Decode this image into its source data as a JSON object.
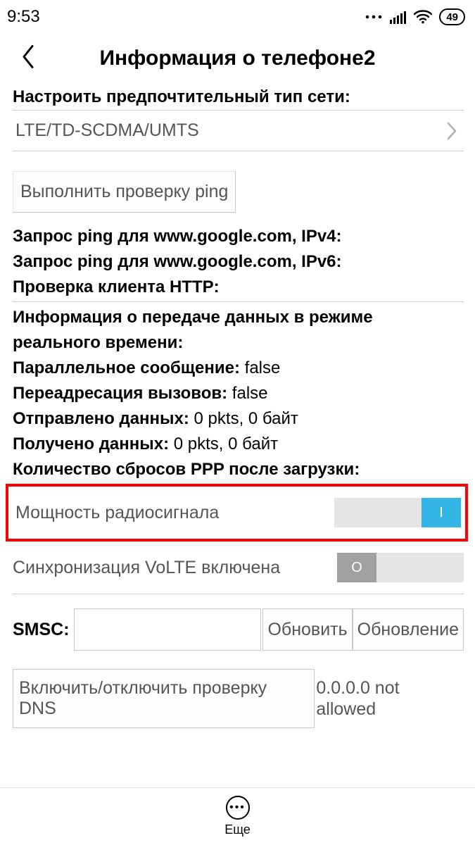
{
  "statusbar": {
    "time": "9:53",
    "battery": "49"
  },
  "title": "Информация о телефоне2",
  "network": {
    "label": "Настроить предпочтительный тип сети:",
    "value": "LTE/TD-SCDMA/UMTS"
  },
  "ping_button": "Выполнить проверку ping",
  "lines": {
    "ping_v4_label": "Запрос ping для www.google.com, IPv4:",
    "ping_v6_label": "Запрос ping для www.google.com, IPv6:",
    "http_label": "Проверка клиента HTTP:",
    "realtime_label": "Информация о передаче данных в режиме реального времени:",
    "concurrent_label": "Параллельное сообщение:",
    "concurrent_value": " false",
    "forward_label": "Переадресация вызовов:",
    "forward_value": " false",
    "sent_label": "Отправлено данных:",
    "sent_value": " 0 pkts, 0 байт",
    "recv_label": "Получено данных:",
    "recv_value": " 0 pkts, 0 байт",
    "ppp_label": "Количество сбросов PPP после загрузки:"
  },
  "toggles": {
    "radio_label": "Мощность радиосигнала",
    "radio_on_glyph": "I",
    "volte_label": "Синхронизация VoLTE включена",
    "volte_off_glyph": "O"
  },
  "smsc": {
    "label": "SMSC:",
    "update": "Обновить",
    "refresh": "Обновление"
  },
  "dns": {
    "button": "Включить/отключить проверку DNS",
    "text": "0.0.0.0 not allowed"
  },
  "bottom": {
    "more": "Еще"
  }
}
